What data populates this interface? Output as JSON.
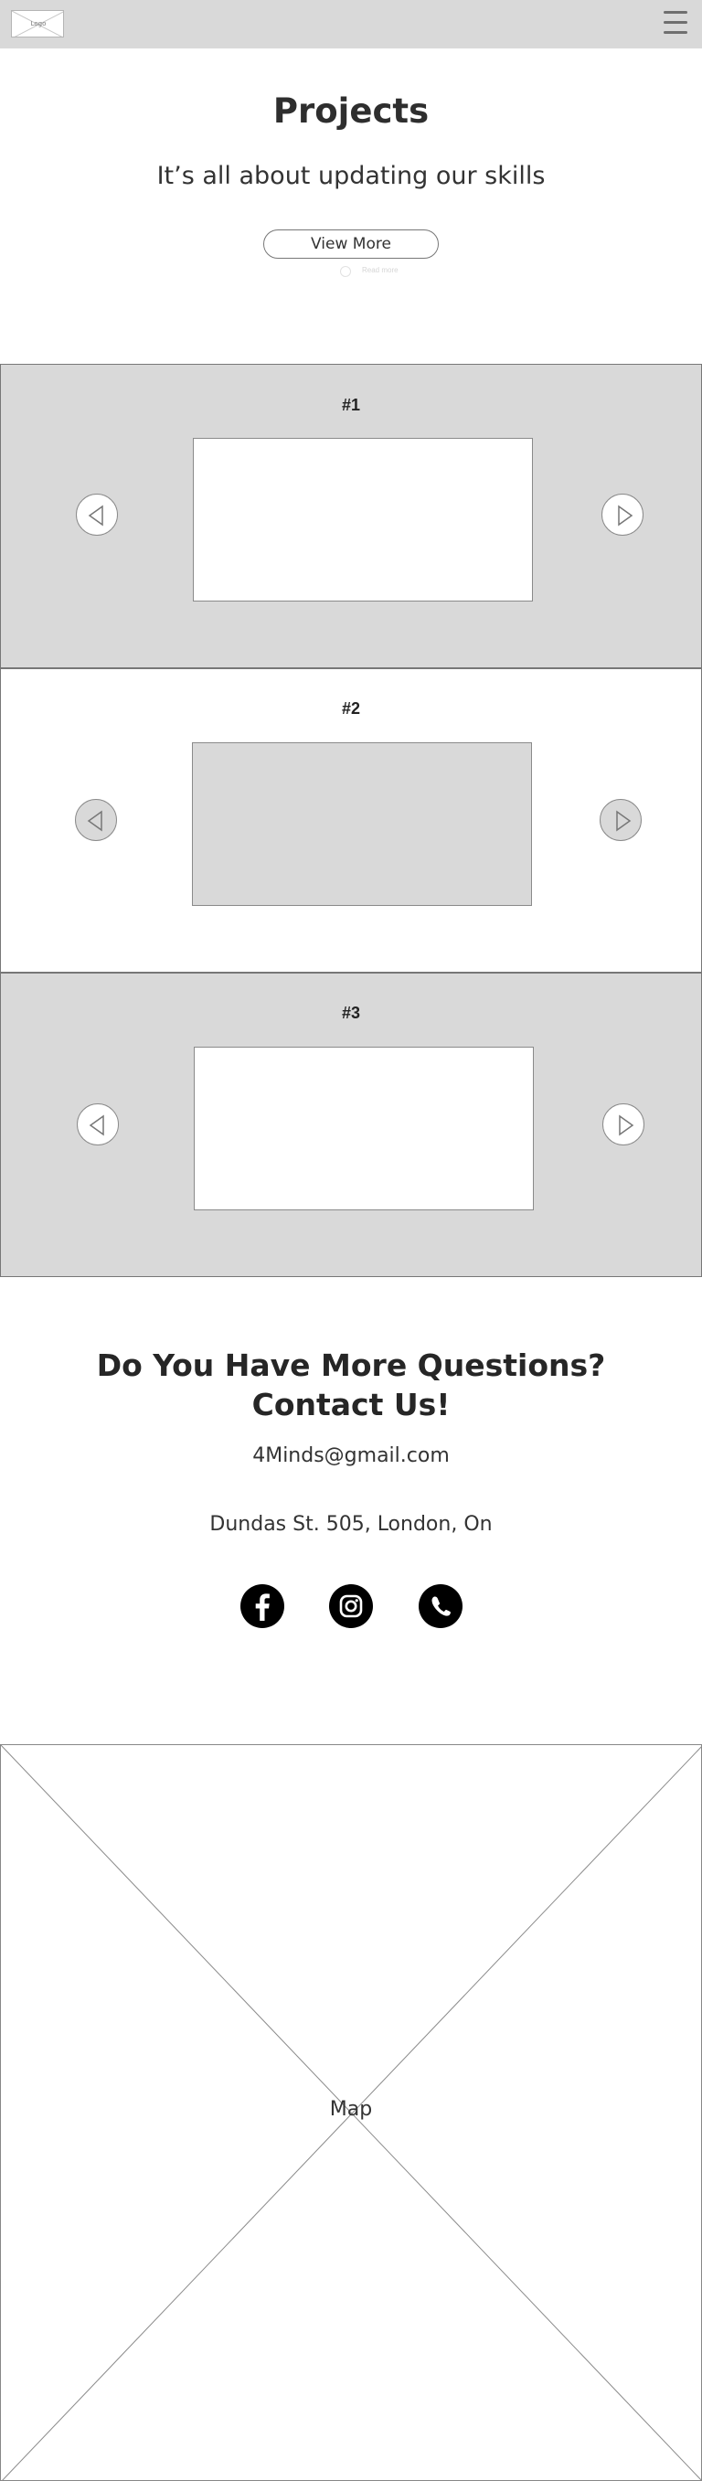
{
  "header": {
    "logo_text": "Logo",
    "logo_icon": "image-placeholder-icon",
    "menu_icon": "hamburger-menu-icon",
    "background": "#d9d9d9"
  },
  "hero": {
    "title": "Projects",
    "subtitle": "It’s all about updating our skills",
    "view_more_label": "View More",
    "faint_label": "Read more"
  },
  "projects": [
    {
      "label": "#1",
      "section_color": "#d9d9d9",
      "slide_color": "#ffffff",
      "arrow_color": "#ffffff"
    },
    {
      "label": "#2",
      "section_color": "#ffffff",
      "slide_color": "#d9d9d9",
      "arrow_color": "#d9d9d9"
    },
    {
      "label": "#3",
      "section_color": "#d9d9d9",
      "slide_color": "#ffffff",
      "arrow_color": "#ffffff"
    }
  ],
  "carousel_icons": {
    "prev": "arrow-left-icon",
    "next": "arrow-right-icon"
  },
  "contact": {
    "heading_line1": "Do You Have More Questions?",
    "heading_line2": "Contact Us!",
    "email": "4Minds@gmail.com",
    "address": "Dundas St. 505, London, On",
    "social": [
      {
        "name": "facebook",
        "icon": "facebook-icon"
      },
      {
        "name": "instagram",
        "icon": "instagram-icon"
      },
      {
        "name": "whatsapp",
        "icon": "whatsapp-icon"
      }
    ]
  },
  "map": {
    "label": "Map",
    "icon": "map-placeholder-icon"
  }
}
